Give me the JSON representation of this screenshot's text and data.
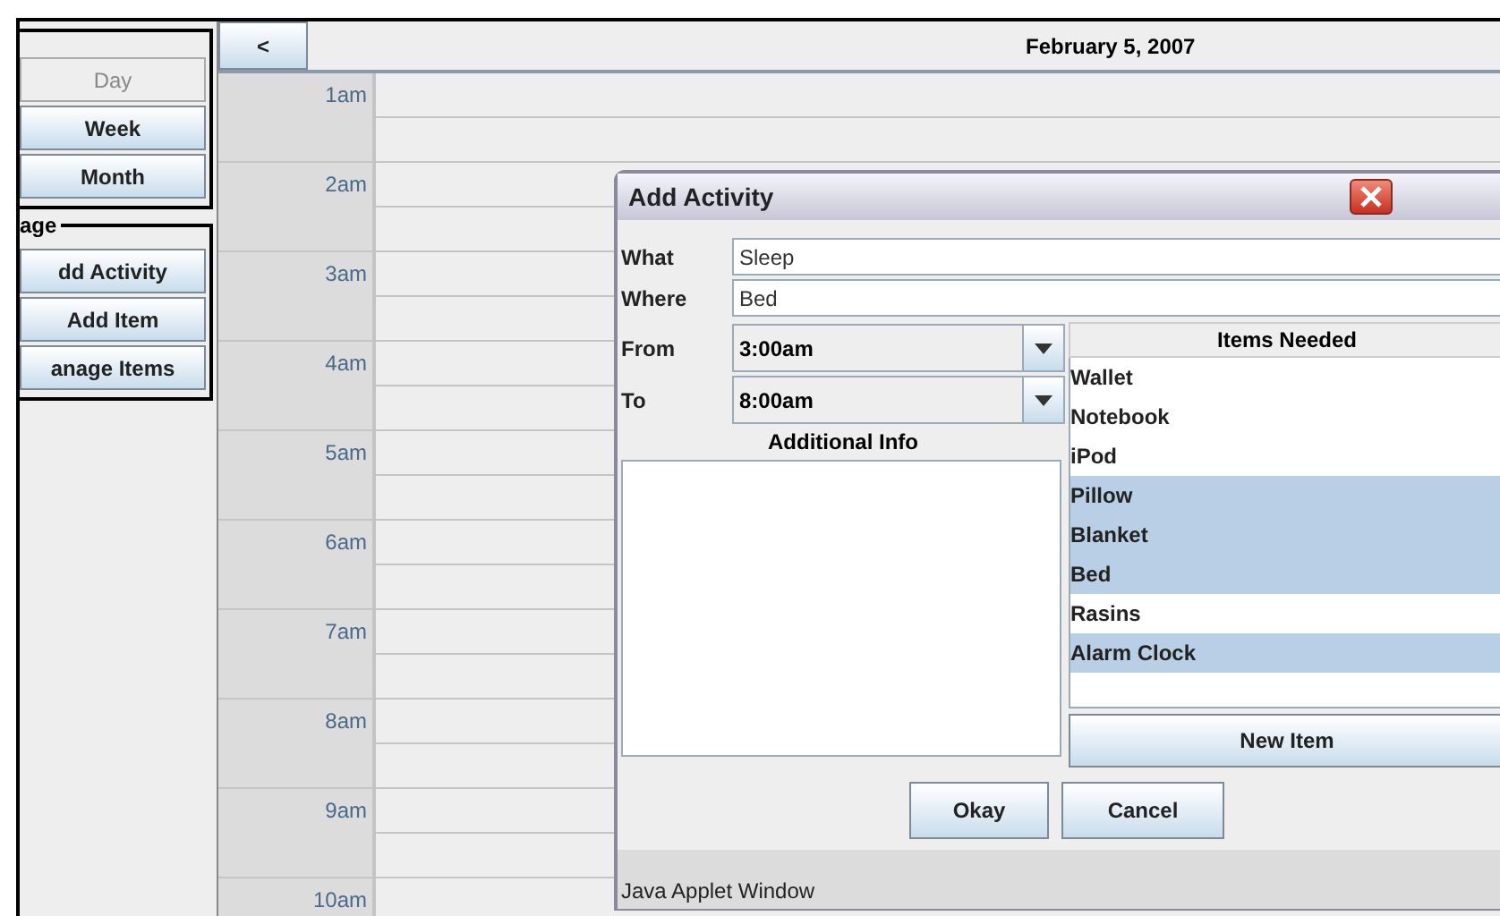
{
  "view_buttons": [
    {
      "label": "Day",
      "disabled": true
    },
    {
      "label": "Week",
      "disabled": false
    },
    {
      "label": "Month",
      "disabled": false
    }
  ],
  "manage_group": {
    "title": "age",
    "buttons": [
      "dd Activity",
      "Add Item",
      "anage Items"
    ]
  },
  "calendar": {
    "prev_button": "<",
    "date": "February 5, 2007",
    "hours": [
      "1am",
      "2am",
      "3am",
      "4am",
      "5am",
      "6am",
      "7am",
      "8am",
      "9am",
      "10am"
    ]
  },
  "dialog": {
    "title": "Add Activity",
    "fields": [
      {
        "label": "What",
        "value": "Sleep"
      },
      {
        "label": "Where",
        "value": "Bed"
      }
    ],
    "times": [
      {
        "label": "From",
        "value": "3:00am"
      },
      {
        "label": "To",
        "value": "8:00am"
      }
    ],
    "info_label": "Additional Info",
    "items_label": "Items Needed",
    "items": [
      {
        "label": "Wallet",
        "selected": false
      },
      {
        "label": "Notebook",
        "selected": false
      },
      {
        "label": "iPod",
        "selected": false
      },
      {
        "label": "Pillow",
        "selected": true
      },
      {
        "label": "Blanket",
        "selected": true
      },
      {
        "label": "Bed",
        "selected": true
      },
      {
        "label": "Rasins",
        "selected": false
      },
      {
        "label": "Alarm Clock",
        "selected": true
      }
    ],
    "new_item_button": "New Item",
    "buttons": [
      "Okay",
      "Cancel"
    ],
    "status": "Java Applet Window"
  }
}
